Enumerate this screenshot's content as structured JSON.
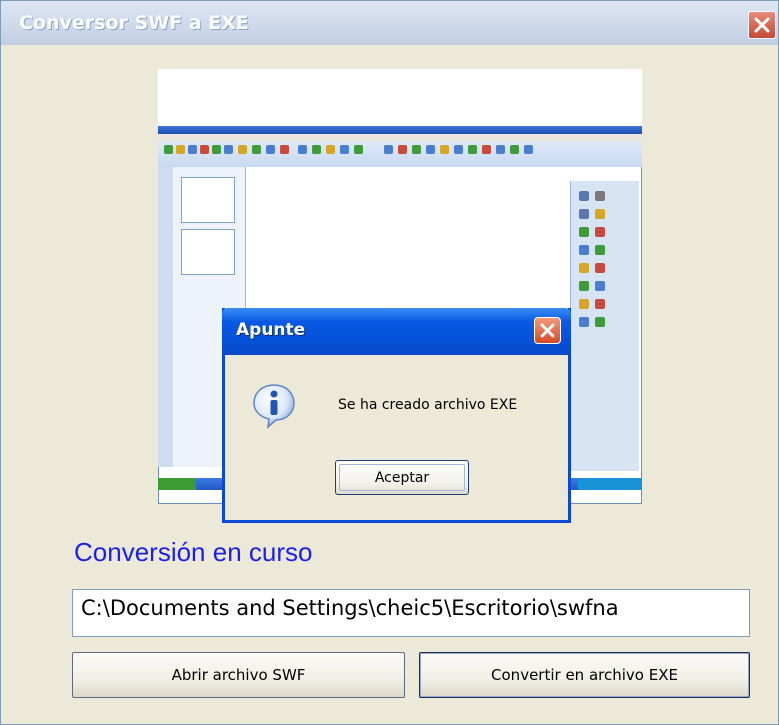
{
  "window": {
    "title": "Conversor SWF a EXE"
  },
  "dialog": {
    "title": "Apunte",
    "message": "Se ha creado archivo EXE",
    "ok_label": "Aceptar"
  },
  "main": {
    "status_heading": "Conversión en curso",
    "path_value": "C:\\Documents and Settings\\cheic5\\Escritorio\\swfna",
    "open_button_label": "Abrir archivo SWF",
    "convert_button_label": "Convertir en archivo EXE"
  },
  "colors": {
    "heading": "#1a1ff0",
    "dialog_title": "#0550d8",
    "window_bg": "#ece9d8"
  },
  "icons": [
    "close-icon",
    "info-icon"
  ]
}
